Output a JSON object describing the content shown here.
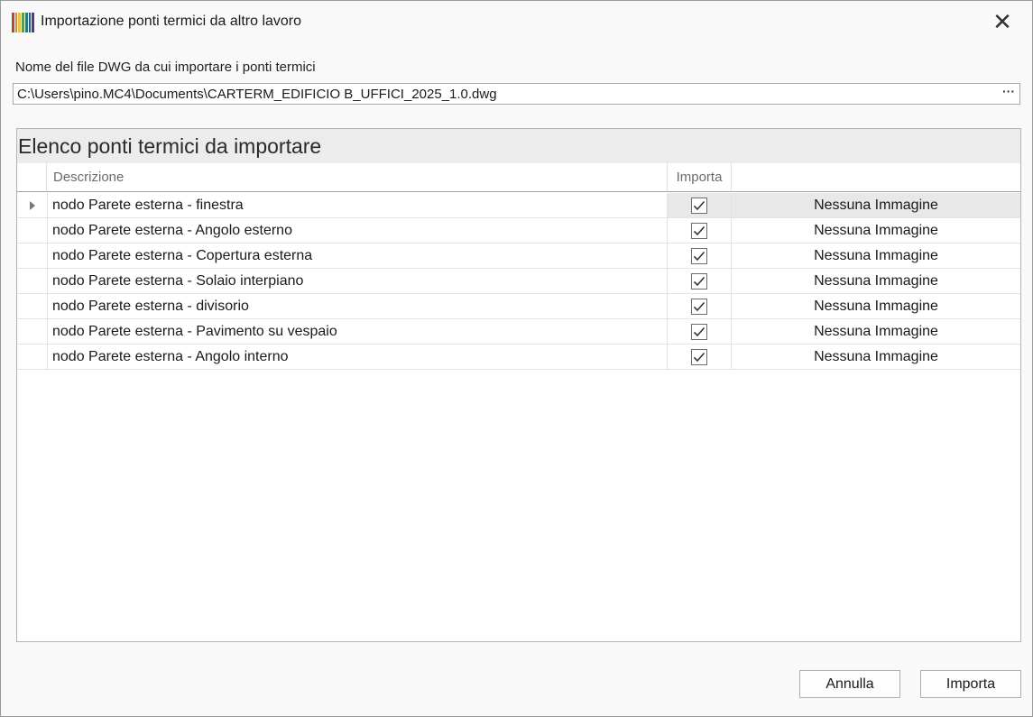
{
  "window": {
    "title": "Importazione ponti termici da altro lavoro",
    "close_glyph": "✕",
    "app_icon_colors": [
      "#b34a2f",
      "#d98b2b",
      "#e3c34a",
      "#5f9b4e",
      "#2e7a80",
      "#2b5b8e",
      "#4f3c7a"
    ]
  },
  "file": {
    "label": "Nome del file DWG da cui importare i ponti termici",
    "value": "C:\\Users\\pino.MC4\\Documents\\CARTERM_EDIFICIO B_UFFICI_2025_1.0.dwg",
    "browse_glyph": "···"
  },
  "grid": {
    "title": "Elenco ponti termici da importare",
    "columns": {
      "description": "Descrizione",
      "import": "Importa",
      "image": ""
    },
    "rows": [
      {
        "description": "nodo Parete esterna - finestra",
        "import": true,
        "image": "Nessuna Immagine",
        "selected": true
      },
      {
        "description": "nodo Parete esterna - Angolo esterno",
        "import": true,
        "image": "Nessuna Immagine",
        "selected": false
      },
      {
        "description": "nodo Parete esterna - Copertura esterna",
        "import": true,
        "image": "Nessuna Immagine",
        "selected": false
      },
      {
        "description": "nodo Parete esterna - Solaio interpiano",
        "import": true,
        "image": "Nessuna Immagine",
        "selected": false
      },
      {
        "description": "nodo Parete esterna - divisorio",
        "import": true,
        "image": "Nessuna Immagine",
        "selected": false
      },
      {
        "description": "nodo Parete esterna - Pavimento su vespaio",
        "import": true,
        "image": "Nessuna Immagine",
        "selected": false
      },
      {
        "description": "nodo Parete esterna - Angolo interno",
        "import": true,
        "image": "Nessuna Immagine",
        "selected": false
      }
    ]
  },
  "buttons": {
    "cancel": "Annulla",
    "import": "Importa"
  }
}
